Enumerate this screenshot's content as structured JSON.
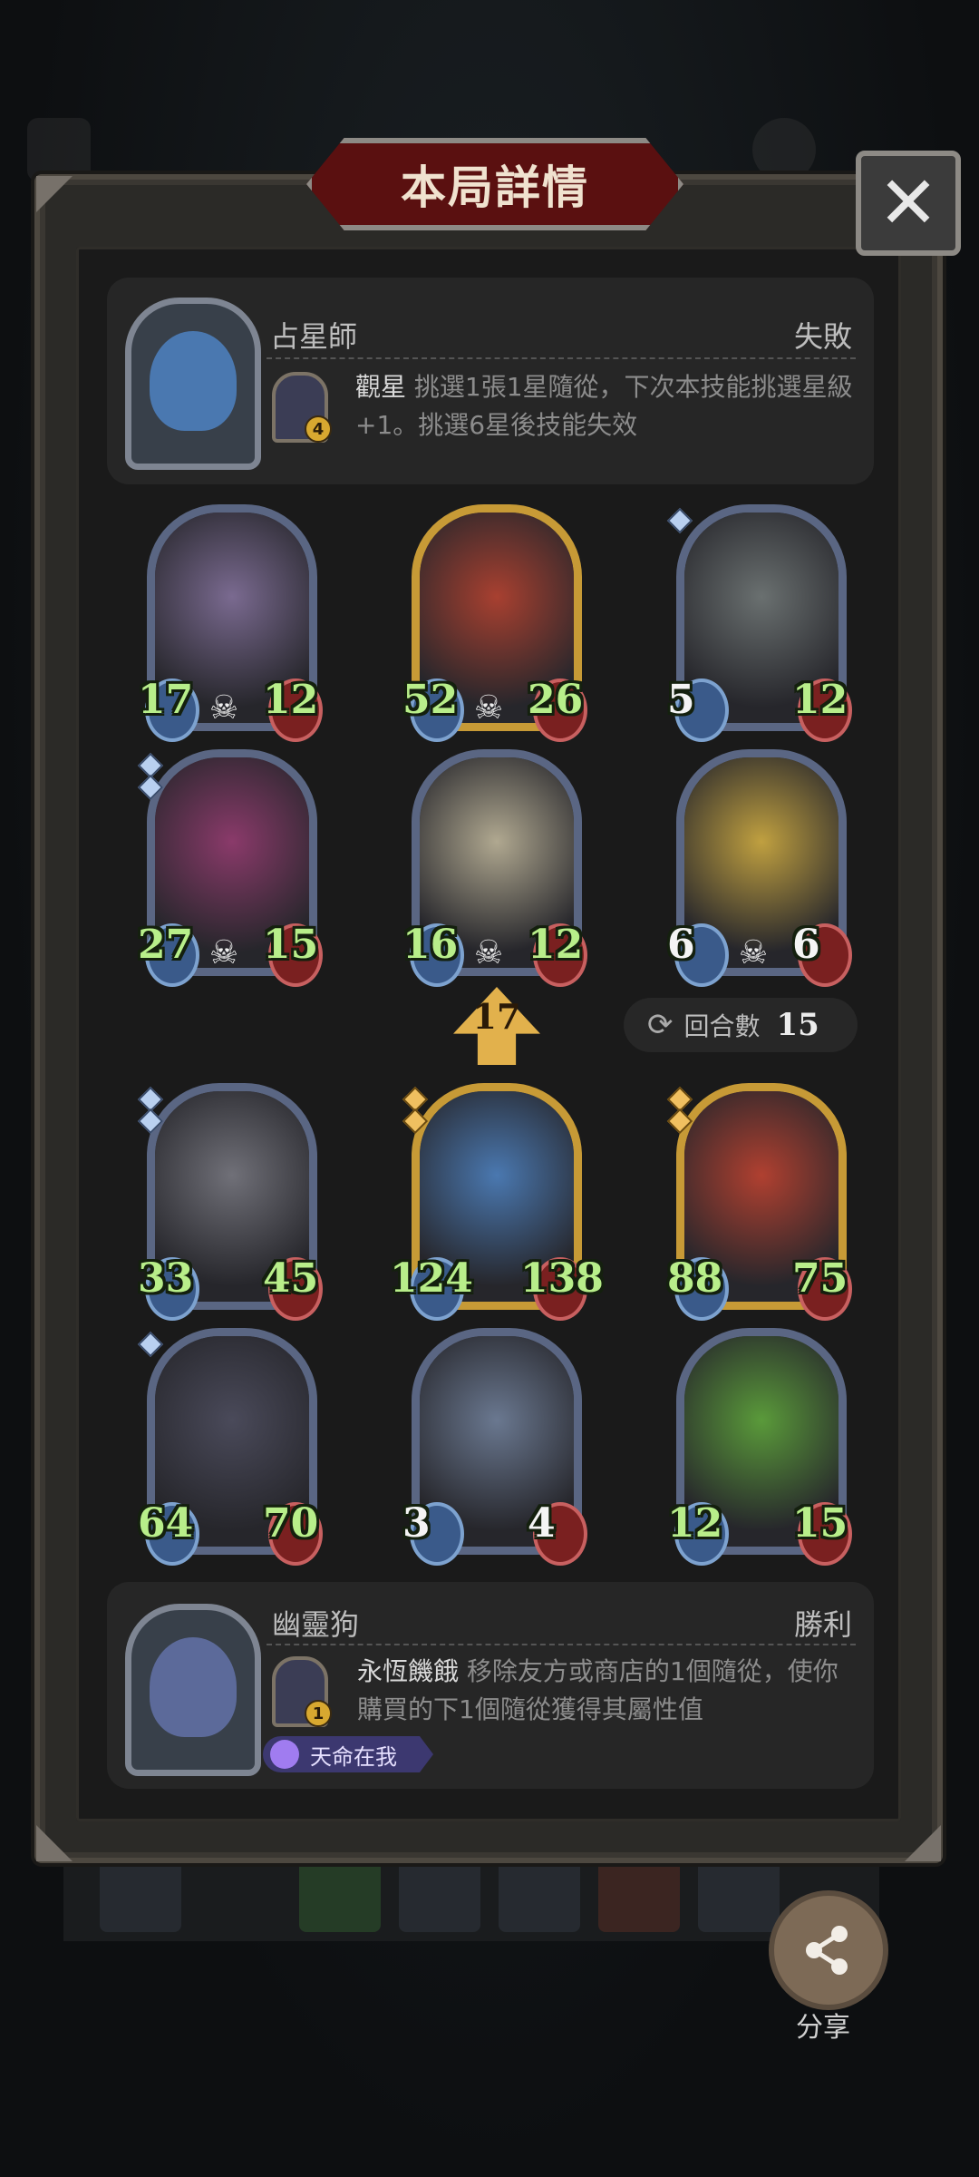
{
  "dialog": {
    "title": "本局詳情",
    "close_label": "✕"
  },
  "opponent_hero": {
    "name": "占星師",
    "result": "失敗",
    "skill_level": "4",
    "skill_name": "觀星",
    "skill_desc": "挑選1張1星隨從，下次本技能挑選星級+1。挑選6星後技能失效"
  },
  "opponent_minions": [
    {
      "attack": "17",
      "health": "12",
      "tier": "silver",
      "stars": 0,
      "skull": true
    },
    {
      "attack": "52",
      "health": "26",
      "tier": "gold",
      "stars": 0,
      "skull": true
    },
    {
      "attack": "5",
      "health": "12",
      "tier": "silver",
      "stars": 1,
      "skull": false
    },
    {
      "attack": "27",
      "health": "15",
      "tier": "silver",
      "stars": 2,
      "skull": true
    },
    {
      "attack": "16",
      "health": "12",
      "tier": "silver",
      "stars": 0,
      "skull": true
    },
    {
      "attack": "6",
      "health": "6",
      "tier": "silver",
      "stars": 0,
      "skull": true
    }
  ],
  "tavern_level": "17",
  "rounds": {
    "label": "回合數",
    "value": "15"
  },
  "player_minions": [
    {
      "attack": "33",
      "health": "45",
      "tier": "silver",
      "stars": 2
    },
    {
      "attack": "124",
      "health": "138",
      "tier": "gold",
      "stars": 2
    },
    {
      "attack": "88",
      "health": "75",
      "tier": "gold",
      "stars": 2
    },
    {
      "attack": "64",
      "health": "70",
      "tier": "silver",
      "stars": 1
    },
    {
      "attack": "3",
      "health": "4",
      "tier": "silver",
      "stars": 0
    },
    {
      "attack": "12",
      "health": "15",
      "tier": "silver",
      "stars": 0
    }
  ],
  "player_hero": {
    "name": "幽靈狗",
    "result": "勝利",
    "skill_level": "1",
    "skill_name": "永恆饑餓",
    "skill_desc": "移除友方或商店的1個隨從，使你購買的下1個隨從獲得其屬性值",
    "badge": "天命在我"
  },
  "share": {
    "label": "分享"
  },
  "colors": {
    "title_banner": "#5a1010",
    "stat_green": "#b8ee8a",
    "gold_frame": "#c79a36",
    "silver_frame": "#5a6683"
  }
}
